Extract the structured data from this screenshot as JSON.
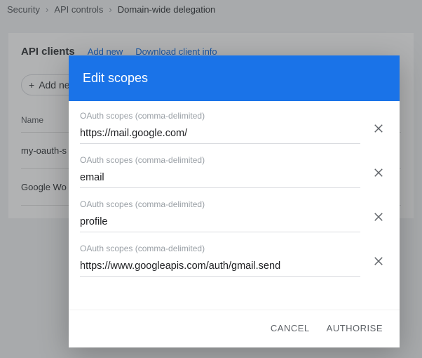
{
  "breadcrumbs": {
    "a": "Security",
    "b": "API controls",
    "c": "Domain-wide delegation"
  },
  "panel": {
    "title": "API clients",
    "link_add": "Add new",
    "link_download": "Download client info",
    "add_button": "Add new",
    "col_name": "Name",
    "rows": [
      "my-oauth-s",
      "Google Wo"
    ]
  },
  "dialog": {
    "title": "Edit scopes",
    "field_label": "OAuth scopes (comma-delimited)",
    "scopes": [
      "https://mail.google.com/",
      "email",
      "profile",
      "https://www.googleapis.com/auth/gmail.send"
    ],
    "cancel": "CANCEL",
    "authorise": "AUTHORISE"
  }
}
